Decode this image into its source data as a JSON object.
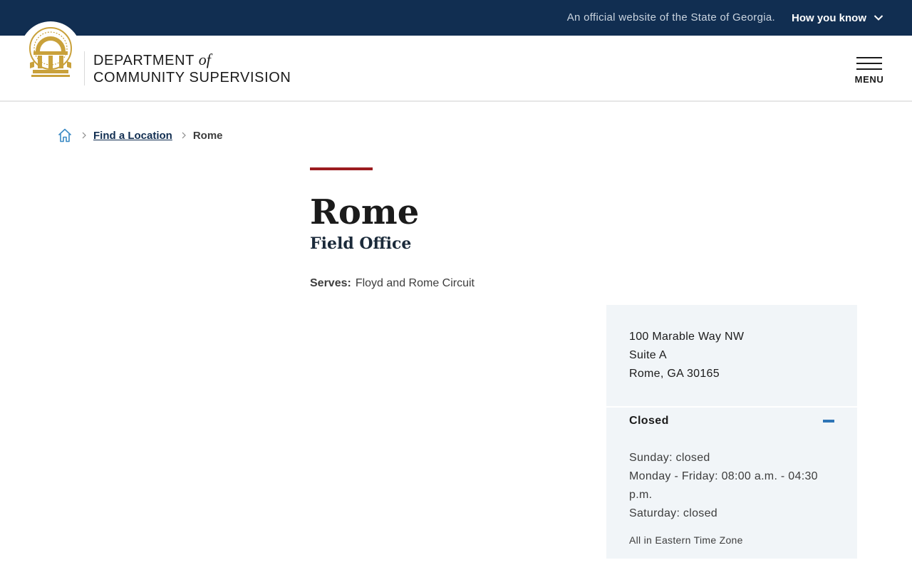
{
  "gov_banner": {
    "official_text": "An official website of the State of Georgia.",
    "how_you_know": "How you know"
  },
  "header": {
    "brand_line1": "DEPARTMENT",
    "brand_of": "of",
    "brand_line2": "COMMUNITY SUPERVISION",
    "menu_label": "MENU"
  },
  "breadcrumb": {
    "link": "Find a Location",
    "current": "Rome"
  },
  "page": {
    "title": "Rome",
    "subtitle": "Field Office",
    "serves_label": "Serves:",
    "serves_value": "Floyd and Rome Circuit"
  },
  "card": {
    "address_line1": "100 Marable Way NW",
    "address_line2": "Suite A",
    "address_line3": "Rome, GA 30165",
    "status": "Closed",
    "hours": [
      "Sunday: closed",
      "Monday - Friday: 08:00 a.m. - 04:30 p.m.",
      "Saturday: closed"
    ],
    "timezone": "All in Eastern Time Zone"
  },
  "colors": {
    "banner_navy": "#112e51",
    "accent_red": "#9b1c1f",
    "seal_gold": "#c9a13b",
    "card_bg": "#f1f5f8",
    "toggle_blue": "#2e75b6"
  },
  "icons": {
    "seal": "georgia-seal-icon",
    "chevron": "chevron-down-icon",
    "home": "home-icon",
    "menu": "hamburger-icon",
    "collapse": "minus-icon"
  }
}
